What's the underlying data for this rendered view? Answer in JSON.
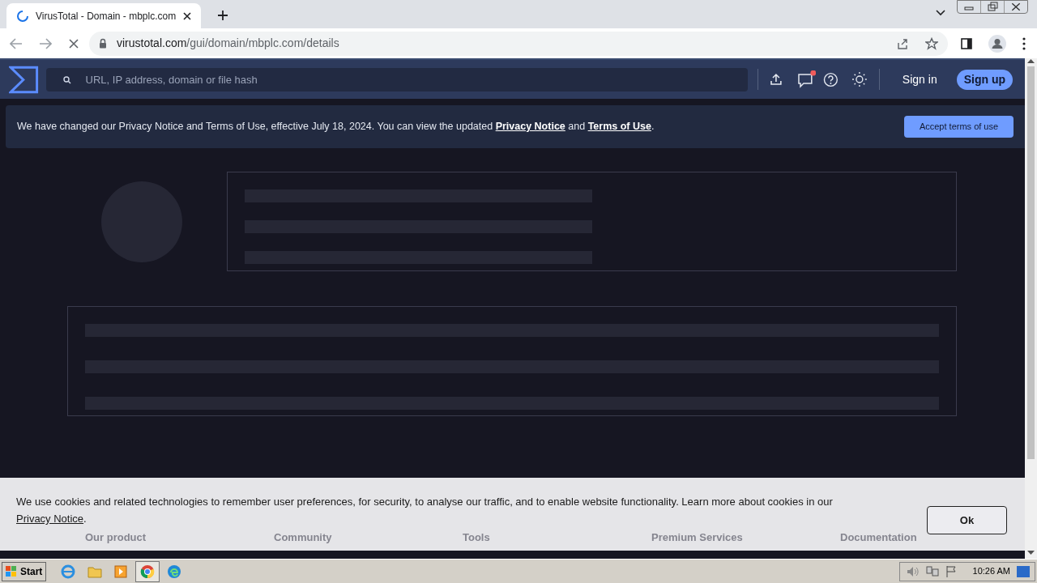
{
  "browser": {
    "tab": {
      "title": "VirusTotal - Domain - mbplc.com",
      "loading": true
    },
    "url": {
      "host": "virustotal.com",
      "path": "/gui/domain/mbplc.com/details"
    }
  },
  "header": {
    "search": {
      "placeholder": "URL, IP address, domain or file hash"
    },
    "notifications_unread": true,
    "sign_in": "Sign in",
    "sign_up": "Sign up"
  },
  "notice": {
    "text": "We have changed our Privacy Notice and Terms of Use, effective July 18, 2024. You can view the updated ",
    "link_1": "Privacy Notice",
    "between": " and ",
    "link_2": "Terms of Use",
    "end": ".",
    "button": "Accept terms of use"
  },
  "cookie_banner": {
    "text": "We use cookies and related technologies to remember user preferences, for security, to analyse our traffic, and to enable website functionality. Learn more about cookies in our ",
    "link": "Privacy Notice",
    "end": ".",
    "button": "Ok"
  },
  "footer": {
    "headings": [
      "Our product",
      "Community",
      "Tools",
      "Premium Services",
      "Documentation"
    ]
  },
  "taskbar": {
    "start": "Start",
    "clock": "10:26 AM"
  }
}
